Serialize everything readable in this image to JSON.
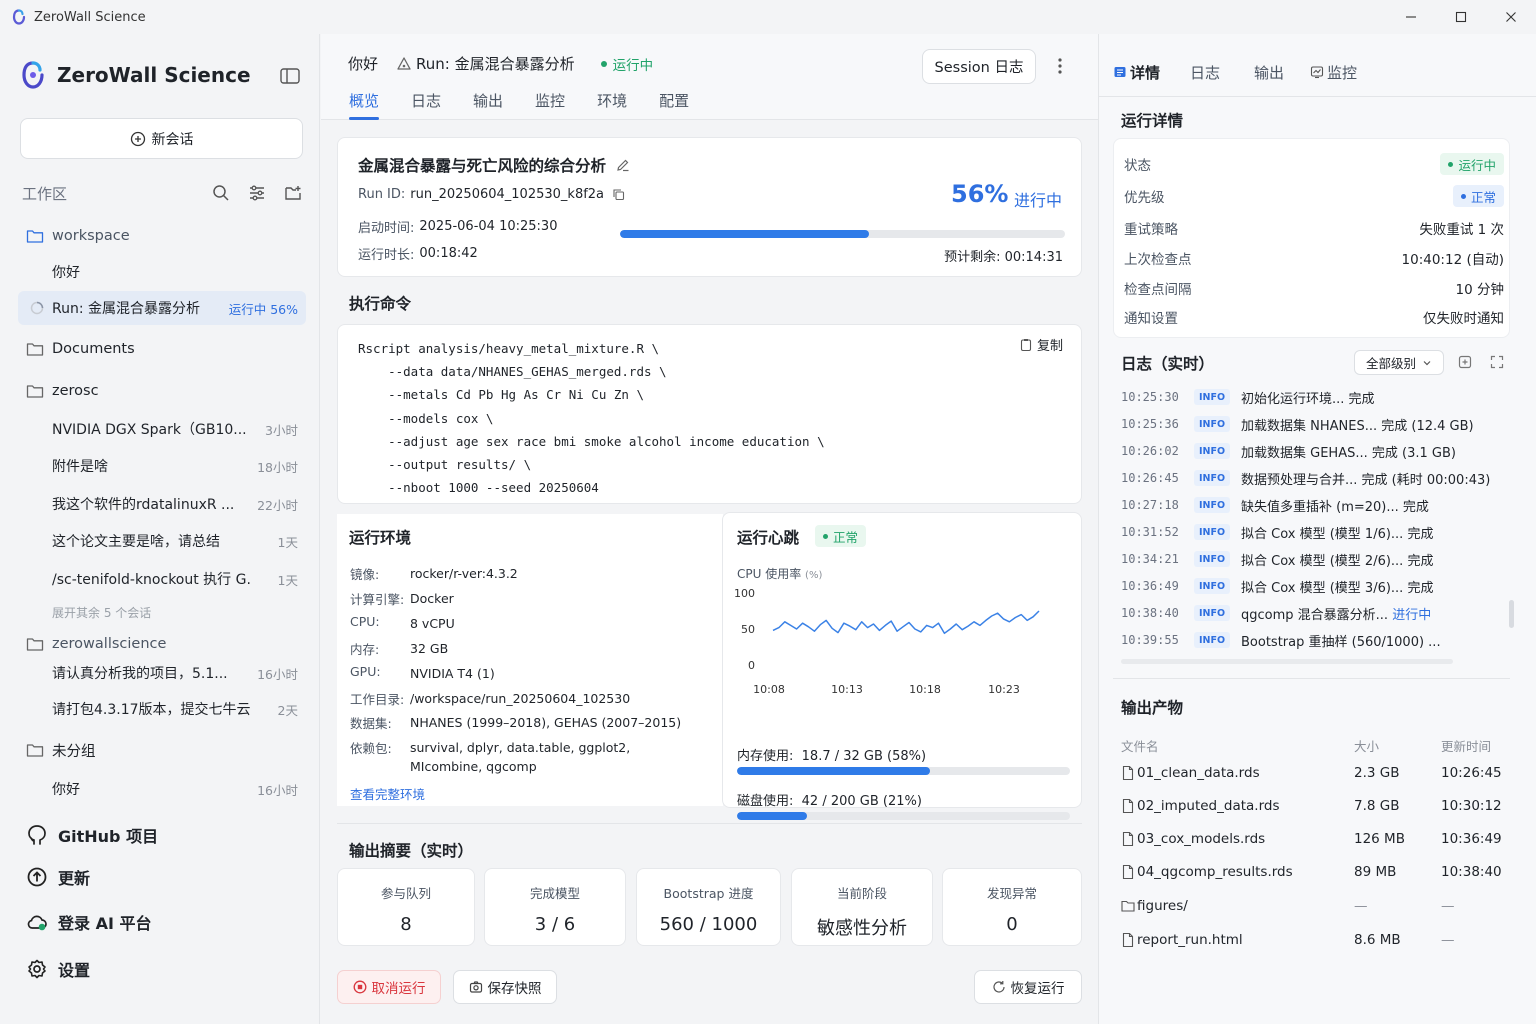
{
  "window": {
    "title": "ZeroWall Science"
  },
  "sidebar": {
    "brand": "ZeroWall Science",
    "new_chat": "新会话",
    "workspace_label": "工作区",
    "rows": [
      {
        "kind": "folder",
        "label": "workspace",
        "style": "blue"
      },
      {
        "kind": "item",
        "label": "你好",
        "time": ""
      },
      {
        "kind": "active",
        "label": "Run: 金属混合暴露分析",
        "status": "运行中  56%"
      },
      {
        "kind": "folder",
        "label": "Documents"
      },
      {
        "kind": "folder",
        "label": "zerosc"
      },
      {
        "kind": "item",
        "label": "NVIDIA DGX Spark（GB10...",
        "time": "3小时"
      },
      {
        "kind": "item",
        "label": "附件是啥",
        "time": "18小时"
      },
      {
        "kind": "item",
        "label": "我这个软件的rdatalinuxR ...",
        "time": "22小时"
      },
      {
        "kind": "item",
        "label": "这个论文主要是啥，请总结",
        "time": "1天"
      },
      {
        "kind": "item",
        "label": "/sc-tenifold-knockout 执行 G...",
        "time": "1天"
      },
      {
        "kind": "more",
        "label": "展开其余 5 个会话"
      },
      {
        "kind": "folder",
        "label": "zerowallscience",
        "style": "gray"
      },
      {
        "kind": "item",
        "label": "请认真分析我的项目，5.1...",
        "time": "16小时"
      },
      {
        "kind": "item",
        "label": "请打包4.3.17版本，提交七牛云",
        "time": "2天"
      },
      {
        "kind": "folder",
        "label": "未分组"
      },
      {
        "kind": "item",
        "label": "你好",
        "time": "16小时"
      }
    ],
    "bottom": [
      {
        "label": "GitHub 项目",
        "icon": "github-icon"
      },
      {
        "label": "更新",
        "icon": "update-icon"
      },
      {
        "label": "登录 AI 平台",
        "icon": "cloud-login-icon"
      },
      {
        "label": "设置",
        "icon": "gear-icon"
      }
    ]
  },
  "main": {
    "crumb_greeting": "你好",
    "crumb_run": "Run: 金属混合暴露分析",
    "crumb_status": "运行中",
    "session_log_button": "Session 日志",
    "tabs": [
      "概览",
      "日志",
      "输出",
      "监控",
      "环境",
      "配置"
    ],
    "progress": {
      "title": "金属混合暴露与死亡风险的综合分析",
      "run_id_label": "Run ID:",
      "run_id": "run_20250604_102530_k8f2a",
      "start_label": "启动时间:",
      "start": "2025-06-04 10:25:30",
      "dur_label": "运行时长:",
      "dur": "00:18:42",
      "percent_text": "56%",
      "percent": 0.56,
      "state": "进行中",
      "eta_label": "预计剩余:",
      "eta": "00:14:31"
    },
    "command": {
      "title": "执行命令",
      "copy": "复制",
      "text": "Rscript analysis/heavy_metal_mixture.R \\\n    --data data/NHANES_GEHAS_merged.rds \\\n    --metals Cd Pb Hg As Cr Ni Cu Zn \\\n    --models cox \\\n    --adjust age sex race bmi smoke alcohol income education \\\n    --output results/ \\\n    --nboot 1000 --seed 20250604"
    },
    "env": {
      "title": "运行环境",
      "rows": [
        {
          "k": "镜像:",
          "v": "rocker/r-ver:4.3.2"
        },
        {
          "k": "计算引擎:",
          "v": "Docker"
        },
        {
          "k": "CPU:",
          "v": "8 vCPU"
        },
        {
          "k": "内存:",
          "v": "32 GB"
        },
        {
          "k": "GPU:",
          "v": "NVIDIA T4 (1)"
        },
        {
          "k": "工作目录:",
          "v": "/workspace/run_20250604_102530"
        },
        {
          "k": "数据集:",
          "v": "NHANES (1999–2018), GEHAS (2007–2015)"
        },
        {
          "k": "依赖包:",
          "v": "survival, dplyr, data.table, ggplot2, MIcombine, qgcomp"
        }
      ],
      "link": "查看完整环境"
    },
    "heartbeat": {
      "title": "运行心跳",
      "status": "正常",
      "cpu_label": "CPU 使用率",
      "cpu_unit": "(%)",
      "mem_label": "内存使用:",
      "mem_value": "18.7 / 32 GB (58%)",
      "mem_ratio": 0.58,
      "disk_label": "磁盘使用:",
      "disk_value": "42 / 200 GB (21%)",
      "disk_ratio": 0.21
    },
    "summary": {
      "title": "输出摘要（实时）",
      "cards": [
        {
          "label": "参与队列",
          "value": "8"
        },
        {
          "label": "完成模型",
          "value": "3 / 6"
        },
        {
          "label": "Bootstrap 进度",
          "value": "560 / 1000"
        },
        {
          "label": "当前阶段",
          "value": "敏感性分析"
        },
        {
          "label": "发现异常",
          "value": "0"
        }
      ]
    },
    "actions": {
      "cancel": "取消运行",
      "snapshot": "保存快照",
      "resume": "恢复运行"
    }
  },
  "chart_data": {
    "type": "line",
    "title": "CPU 使用率",
    "ylabel": "(%)",
    "ylim": [
      0,
      100
    ],
    "yticks": [
      100,
      50,
      0
    ],
    "xticks": [
      "10:08",
      "10:13",
      "10:18",
      "10:23"
    ],
    "series": [
      {
        "name": "",
        "values": [
          48,
          52,
          60,
          55,
          50,
          58,
          53,
          47,
          56,
          62,
          51,
          45,
          58,
          54,
          49,
          60,
          52,
          57,
          48,
          55,
          61,
          47,
          53,
          59,
          50,
          46,
          55,
          52,
          58,
          44,
          50,
          57,
          49,
          54,
          60,
          55,
          62,
          68,
          72,
          64,
          60,
          66,
          70,
          62,
          67,
          75
        ]
      }
    ]
  },
  "right": {
    "tabs": [
      "详情",
      "日志",
      "输出",
      "监控"
    ],
    "details_title": "运行详情",
    "details": [
      {
        "k": "状态",
        "v": "运行中",
        "pill": "green"
      },
      {
        "k": "优先级",
        "v": "正常",
        "pill": "blue"
      },
      {
        "k": "重试策略",
        "v": "失败重试 1 次"
      },
      {
        "k": "上次检查点",
        "v": "10:40:12 (自动)"
      },
      {
        "k": "检查点间隔",
        "v": "10 分钟"
      },
      {
        "k": "通知设置",
        "v": "仅失败时通知"
      }
    ],
    "log_title": "日志（实时）",
    "log_level": "全部级别",
    "logs": [
      {
        "t": "10:25:30",
        "lvl": "INFO",
        "msg": "初始化运行环境... 完成"
      },
      {
        "t": "10:25:36",
        "lvl": "INFO",
        "msg": "加载数据集 NHANES... 完成 (12.4 GB)"
      },
      {
        "t": "10:26:02",
        "lvl": "INFO",
        "msg": "加载数据集 GEHAS... 完成 (3.1 GB)"
      },
      {
        "t": "10:26:45",
        "lvl": "INFO",
        "msg": "数据预处理与合并... 完成 (耗时 00:00:43)"
      },
      {
        "t": "10:27:18",
        "lvl": "INFO",
        "msg": "缺失值多重插补 (m=20)... 完成"
      },
      {
        "t": "10:31:52",
        "lvl": "INFO",
        "msg": "拟合 Cox 模型 (模型 1/6)... 完成"
      },
      {
        "t": "10:34:21",
        "lvl": "INFO",
        "msg": "拟合 Cox 模型 (模型 2/6)... 完成"
      },
      {
        "t": "10:36:49",
        "lvl": "INFO",
        "msg": "拟合 Cox 模型 (模型 3/6)... 完成"
      },
      {
        "t": "10:38:40",
        "lvl": "INFO",
        "msg": "qgcomp 混合暴露分析... ",
        "tail": "进行中"
      },
      {
        "t": "10:39:55",
        "lvl": "INFO",
        "msg": "Bootstrap 重抽样 (560/1000) ..."
      }
    ],
    "outputs_title": "输出产物",
    "out_headers": [
      "文件名",
      "大小",
      "更新时间"
    ],
    "outputs": [
      {
        "name": "01_clean_data.rds",
        "size": "2.3 GB",
        "time": "10:26:45"
      },
      {
        "name": "02_imputed_data.rds",
        "size": "7.8 GB",
        "time": "10:30:12"
      },
      {
        "name": "03_cox_models.rds",
        "size": "126 MB",
        "time": "10:36:49"
      },
      {
        "name": "04_qgcomp_results.rds",
        "size": "89 MB",
        "time": "10:38:40"
      },
      {
        "name": "figures/",
        "size": "—",
        "time": "—",
        "folder": true
      },
      {
        "name": "report_run.html",
        "size": "8.6 MB",
        "time": "—"
      }
    ]
  }
}
